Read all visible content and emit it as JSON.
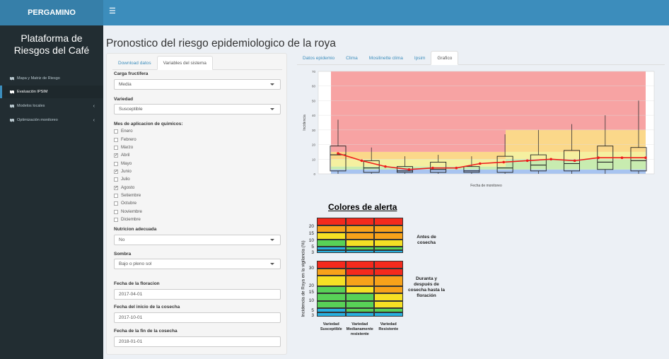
{
  "header": {
    "logo_text": "PERGAMINO",
    "menu_icon": "hamburger-icon"
  },
  "sidebar": {
    "title": "Plataforma de Riesgos del Café",
    "items": [
      {
        "label": "Mapa y Matriz de Riesgo",
        "icon": "map-icon",
        "active": false,
        "has_chevron": false
      },
      {
        "label": "Evaluación IPSIM",
        "icon": "map-icon",
        "active": true,
        "has_chevron": false
      },
      {
        "label": "Modelos locales",
        "icon": "map-icon",
        "active": false,
        "has_chevron": true
      },
      {
        "label": "Optimización monitoreo",
        "icon": "map-icon",
        "active": false,
        "has_chevron": true
      }
    ]
  },
  "page_title": "Pronostico del riesgo epidemiologico de la roya",
  "left_tabs": [
    {
      "label": "Download datos",
      "active": false
    },
    {
      "label": "Variables del sistema",
      "active": true
    }
  ],
  "form": {
    "carga_label": "Carga fructifera",
    "carga_value": "Media",
    "variedad_label": "Variedad",
    "variedad_value": "Susceptible",
    "mes_label": "Mes de aplicacion de quimicos:",
    "months": [
      {
        "name": "Enero",
        "checked": false
      },
      {
        "name": "Febrero",
        "checked": false
      },
      {
        "name": "Marzo",
        "checked": false
      },
      {
        "name": "Abril",
        "checked": true
      },
      {
        "name": "Mayo",
        "checked": false
      },
      {
        "name": "Junio",
        "checked": true
      },
      {
        "name": "Julio",
        "checked": false
      },
      {
        "name": "Agosto",
        "checked": true
      },
      {
        "name": "Setiembre",
        "checked": false
      },
      {
        "name": "Octubre",
        "checked": false
      },
      {
        "name": "Noviembre",
        "checked": false
      },
      {
        "name": "Diciembre",
        "checked": false
      }
    ],
    "nutricion_label": "Nutricion adecuada",
    "nutricion_value": "No",
    "sombra_label": "Sombra",
    "sombra_value": "Bajo o pleno sol",
    "floracion_label": "Fecha de la floracion",
    "floracion_value": "2017-04-01",
    "inicio_label": "Fecha del inicio de la cosecha",
    "inicio_value": "2017-10-01",
    "fin_label": "Fecha de la fin de la cosecha",
    "fin_value": "2018-01-01"
  },
  "right_tabs": [
    {
      "label": "Datos epidemio",
      "active": false
    },
    {
      "label": "Clima",
      "active": false
    },
    {
      "label": "Mosilinette clima",
      "active": false
    },
    {
      "label": "Ipsim",
      "active": false
    },
    {
      "label": "Grafico",
      "active": true
    }
  ],
  "chart_data": {
    "type": "box",
    "xlabel": "Fecha de monitoreo",
    "ylabel": "Incidencia",
    "ylim": [
      0,
      70
    ],
    "yticks": [
      0,
      10,
      20,
      30,
      40,
      50,
      60,
      70
    ],
    "boxes": [
      {
        "q1": 2,
        "med": 13,
        "q3": 19,
        "min": 0,
        "max": 37
      },
      {
        "q1": 1,
        "med": 4,
        "q3": 9,
        "min": 0,
        "max": 18
      },
      {
        "q1": 1,
        "med": 2,
        "q3": 5,
        "min": 0,
        "max": 12
      },
      {
        "q1": 1,
        "med": 3,
        "q3": 8,
        "min": 0,
        "max": 13
      },
      {
        "q1": 1,
        "med": 2,
        "q3": 5,
        "min": 0,
        "max": 12
      },
      {
        "q1": 1,
        "med": 4,
        "q3": 12,
        "min": 0,
        "max": 27
      },
      {
        "q1": 2,
        "med": 6,
        "q3": 13,
        "min": 0,
        "max": 30
      },
      {
        "q1": 2,
        "med": 7,
        "q3": 16,
        "min": 0,
        "max": 34
      },
      {
        "q1": 3,
        "med": 8,
        "q3": 19,
        "min": 0,
        "max": 40
      },
      {
        "q1": 2,
        "med": 9,
        "q3": 18,
        "min": 0,
        "max": 50
      }
    ],
    "prediction": [
      14,
      9,
      5,
      3,
      4,
      4,
      7,
      8,
      9,
      10,
      9,
      11,
      11,
      11
    ],
    "series_color": "#ee1c1c",
    "zones": {
      "before_harvest": [
        {
          "from": 0,
          "to": 3,
          "color": "#a8c4f0"
        },
        {
          "from": 3,
          "to": 5,
          "color": "#c8ecb0"
        },
        {
          "from": 5,
          "to": 10,
          "color": "#f5f0a0"
        },
        {
          "from": 10,
          "to": 15,
          "color": "#fbd88a"
        },
        {
          "from": 15,
          "to": 70,
          "color": "#f7a3a3"
        }
      ],
      "after_harvest": [
        {
          "from": 0,
          "to": 3,
          "color": "#a8c4f0"
        },
        {
          "from": 3,
          "to": 10,
          "color": "#c8ecb0"
        },
        {
          "from": 10,
          "to": 15,
          "color": "#f5f0a0"
        },
        {
          "from": 15,
          "to": 30,
          "color": "#fbd88a"
        },
        {
          "from": 30,
          "to": 70,
          "color": "#f7a3a3"
        }
      ]
    }
  },
  "alert_legend": {
    "title": "Colores de alerta",
    "ylabel": "Incidencia de Roya en la vigilancia (%)",
    "top_ticks": [
      "20",
      "15",
      "10",
      "5",
      "3"
    ],
    "bottom_ticks": [
      "30",
      "20",
      "15",
      "10",
      "5",
      "3"
    ],
    "top_side_label": "Antes de cosecha",
    "bottom_side_label": "Duranta y después de cosecha hasta la floración",
    "columns": [
      {
        "line1": "Variedad",
        "line2": "Susceptible",
        "line3": ""
      },
      {
        "line1": "Variedad",
        "line2": "Medianamente",
        "line3": "resistente"
      },
      {
        "line1": "Variedad",
        "line2": "Resistente",
        "line3": ""
      }
    ],
    "colors": {
      "red": "#f42a1d",
      "orange": "#f7a21a",
      "yellow": "#f6e024",
      "green": "#58d157",
      "cyan": "#27b0df"
    }
  }
}
